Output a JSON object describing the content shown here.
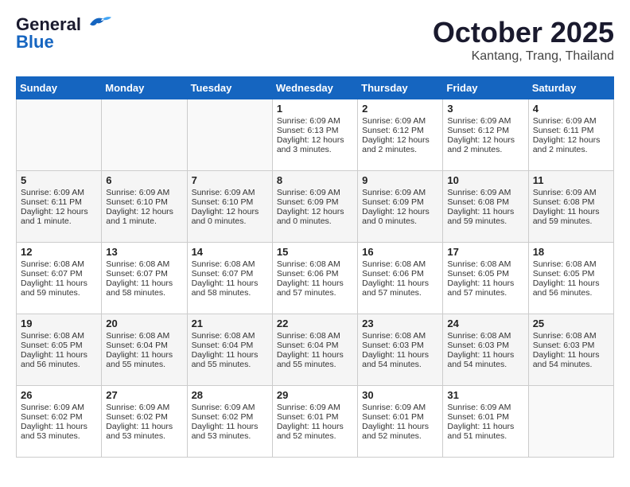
{
  "header": {
    "logo_line1": "General",
    "logo_line2": "Blue",
    "month": "October 2025",
    "location": "Kantang, Trang, Thailand"
  },
  "weekdays": [
    "Sunday",
    "Monday",
    "Tuesday",
    "Wednesday",
    "Thursday",
    "Friday",
    "Saturday"
  ],
  "weeks": [
    [
      {
        "day": "",
        "info": ""
      },
      {
        "day": "",
        "info": ""
      },
      {
        "day": "",
        "info": ""
      },
      {
        "day": "1",
        "info": "Sunrise: 6:09 AM\nSunset: 6:13 PM\nDaylight: 12 hours and 3 minutes."
      },
      {
        "day": "2",
        "info": "Sunrise: 6:09 AM\nSunset: 6:12 PM\nDaylight: 12 hours and 2 minutes."
      },
      {
        "day": "3",
        "info": "Sunrise: 6:09 AM\nSunset: 6:12 PM\nDaylight: 12 hours and 2 minutes."
      },
      {
        "day": "4",
        "info": "Sunrise: 6:09 AM\nSunset: 6:11 PM\nDaylight: 12 hours and 2 minutes."
      }
    ],
    [
      {
        "day": "5",
        "info": "Sunrise: 6:09 AM\nSunset: 6:11 PM\nDaylight: 12 hours and 1 minute."
      },
      {
        "day": "6",
        "info": "Sunrise: 6:09 AM\nSunset: 6:10 PM\nDaylight: 12 hours and 1 minute."
      },
      {
        "day": "7",
        "info": "Sunrise: 6:09 AM\nSunset: 6:10 PM\nDaylight: 12 hours and 0 minutes."
      },
      {
        "day": "8",
        "info": "Sunrise: 6:09 AM\nSunset: 6:09 PM\nDaylight: 12 hours and 0 minutes."
      },
      {
        "day": "9",
        "info": "Sunrise: 6:09 AM\nSunset: 6:09 PM\nDaylight: 12 hours and 0 minutes."
      },
      {
        "day": "10",
        "info": "Sunrise: 6:09 AM\nSunset: 6:08 PM\nDaylight: 11 hours and 59 minutes."
      },
      {
        "day": "11",
        "info": "Sunrise: 6:09 AM\nSunset: 6:08 PM\nDaylight: 11 hours and 59 minutes."
      }
    ],
    [
      {
        "day": "12",
        "info": "Sunrise: 6:08 AM\nSunset: 6:07 PM\nDaylight: 11 hours and 59 minutes."
      },
      {
        "day": "13",
        "info": "Sunrise: 6:08 AM\nSunset: 6:07 PM\nDaylight: 11 hours and 58 minutes."
      },
      {
        "day": "14",
        "info": "Sunrise: 6:08 AM\nSunset: 6:07 PM\nDaylight: 11 hours and 58 minutes."
      },
      {
        "day": "15",
        "info": "Sunrise: 6:08 AM\nSunset: 6:06 PM\nDaylight: 11 hours and 57 minutes."
      },
      {
        "day": "16",
        "info": "Sunrise: 6:08 AM\nSunset: 6:06 PM\nDaylight: 11 hours and 57 minutes."
      },
      {
        "day": "17",
        "info": "Sunrise: 6:08 AM\nSunset: 6:05 PM\nDaylight: 11 hours and 57 minutes."
      },
      {
        "day": "18",
        "info": "Sunrise: 6:08 AM\nSunset: 6:05 PM\nDaylight: 11 hours and 56 minutes."
      }
    ],
    [
      {
        "day": "19",
        "info": "Sunrise: 6:08 AM\nSunset: 6:05 PM\nDaylight: 11 hours and 56 minutes."
      },
      {
        "day": "20",
        "info": "Sunrise: 6:08 AM\nSunset: 6:04 PM\nDaylight: 11 hours and 55 minutes."
      },
      {
        "day": "21",
        "info": "Sunrise: 6:08 AM\nSunset: 6:04 PM\nDaylight: 11 hours and 55 minutes."
      },
      {
        "day": "22",
        "info": "Sunrise: 6:08 AM\nSunset: 6:04 PM\nDaylight: 11 hours and 55 minutes."
      },
      {
        "day": "23",
        "info": "Sunrise: 6:08 AM\nSunset: 6:03 PM\nDaylight: 11 hours and 54 minutes."
      },
      {
        "day": "24",
        "info": "Sunrise: 6:08 AM\nSunset: 6:03 PM\nDaylight: 11 hours and 54 minutes."
      },
      {
        "day": "25",
        "info": "Sunrise: 6:08 AM\nSunset: 6:03 PM\nDaylight: 11 hours and 54 minutes."
      }
    ],
    [
      {
        "day": "26",
        "info": "Sunrise: 6:09 AM\nSunset: 6:02 PM\nDaylight: 11 hours and 53 minutes."
      },
      {
        "day": "27",
        "info": "Sunrise: 6:09 AM\nSunset: 6:02 PM\nDaylight: 11 hours and 53 minutes."
      },
      {
        "day": "28",
        "info": "Sunrise: 6:09 AM\nSunset: 6:02 PM\nDaylight: 11 hours and 53 minutes."
      },
      {
        "day": "29",
        "info": "Sunrise: 6:09 AM\nSunset: 6:01 PM\nDaylight: 11 hours and 52 minutes."
      },
      {
        "day": "30",
        "info": "Sunrise: 6:09 AM\nSunset: 6:01 PM\nDaylight: 11 hours and 52 minutes."
      },
      {
        "day": "31",
        "info": "Sunrise: 6:09 AM\nSunset: 6:01 PM\nDaylight: 11 hours and 51 minutes."
      },
      {
        "day": "",
        "info": ""
      }
    ]
  ]
}
